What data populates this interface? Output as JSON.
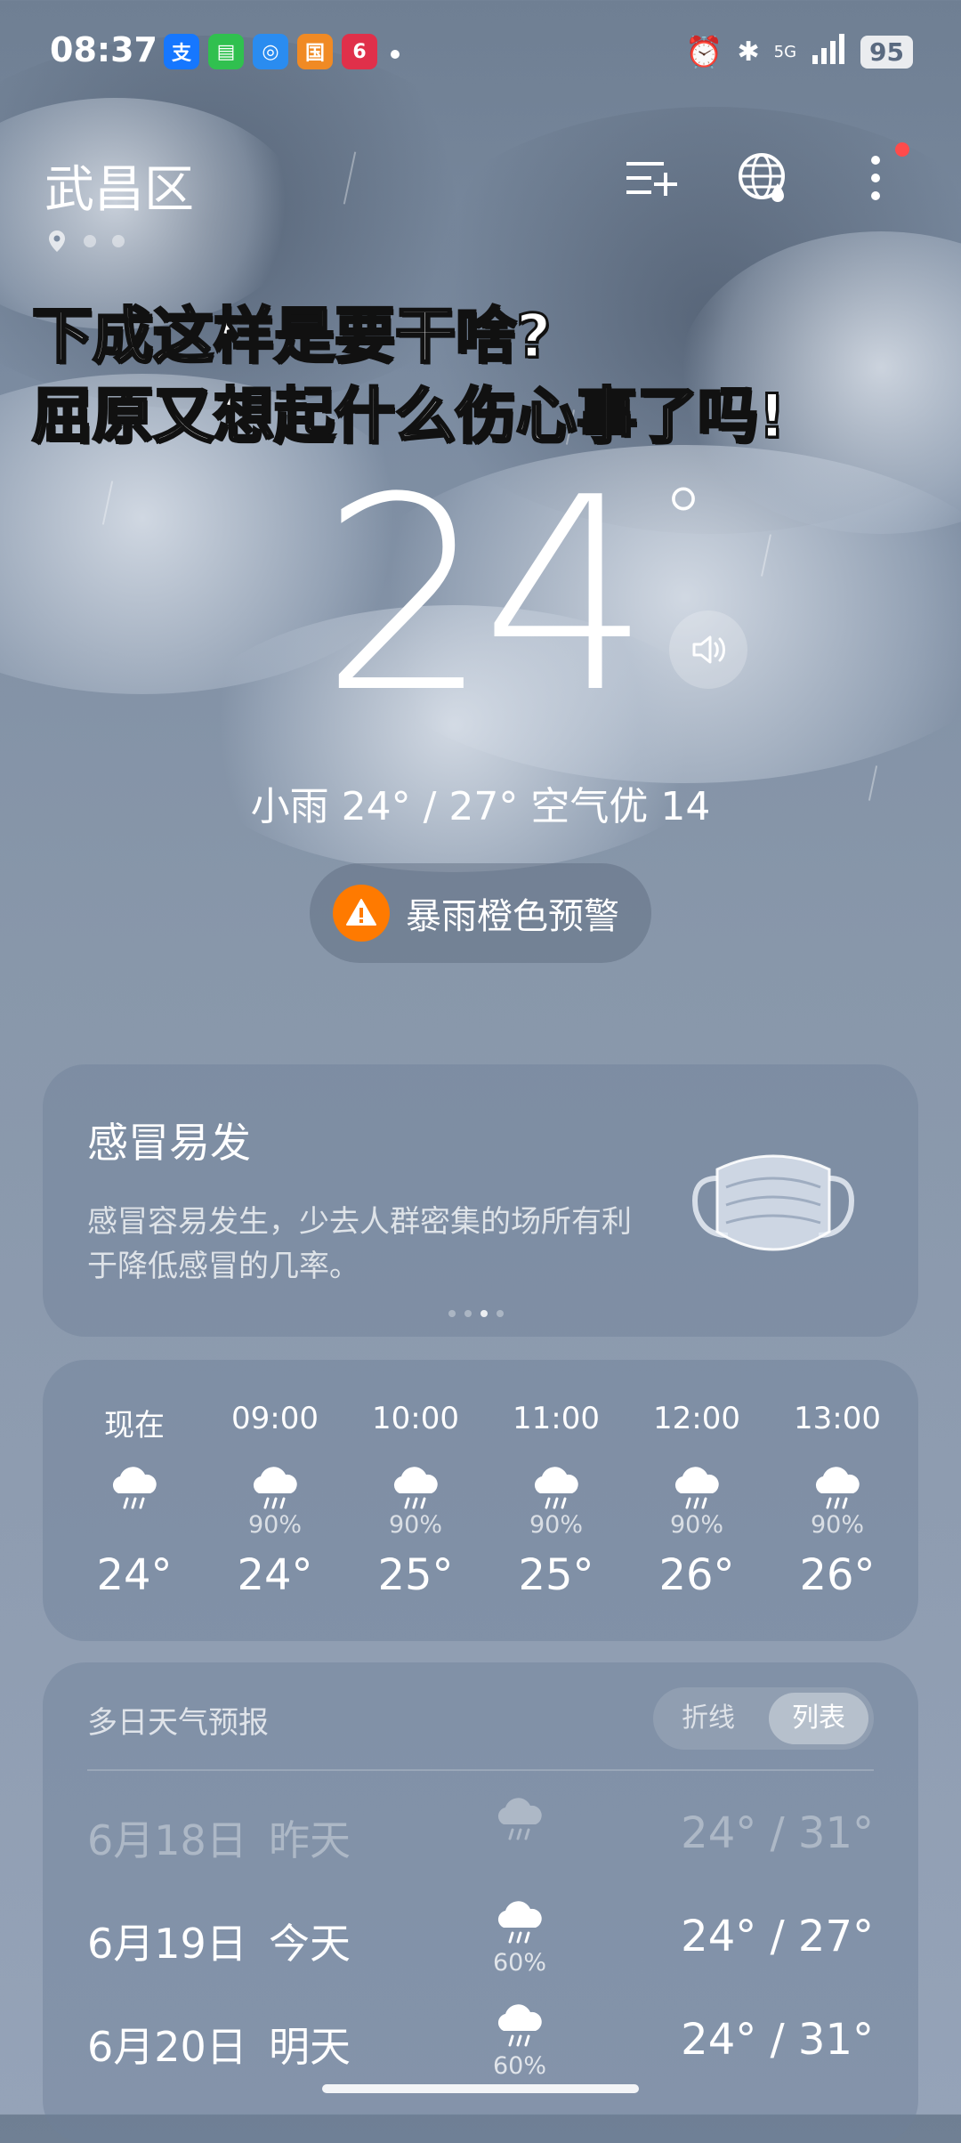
{
  "status_bar": {
    "time": "08:37",
    "battery": "95",
    "network": "5G",
    "app_icons": [
      {
        "glyph": "支",
        "color": "#1677ff",
        "name": "alipay-icon"
      },
      {
        "glyph": "▤",
        "color": "#30c04f",
        "name": "messages-icon"
      },
      {
        "glyph": "◎",
        "color": "#2a8cf0",
        "name": "app-icon"
      },
      {
        "glyph": "国",
        "color": "#f08a24",
        "name": "national-app-icon"
      },
      {
        "glyph": "6",
        "color": "#e0304a",
        "name": "shopping-app-icon"
      }
    ]
  },
  "header": {
    "city": "武昌区"
  },
  "caption": {
    "line1": "下成这样是要干啥?",
    "line2": "屈原又想起什么伤心事了吗!"
  },
  "current": {
    "temperature": "24",
    "degree_symbol": "°",
    "summary": "小雨  24° / 27°  空气优 14"
  },
  "alert": {
    "label": "暴雨橙色预警",
    "color": "#ff7a00"
  },
  "tip_card": {
    "title": "感冒易发",
    "text": "感冒容易发生，少去人群密集的场所有利于降低感冒的几率。",
    "pages": 4,
    "active_page": 3
  },
  "hourly": [
    {
      "time": "现在",
      "precip": "",
      "temp": "24°"
    },
    {
      "time": "09:00",
      "precip": "90%",
      "temp": "24°"
    },
    {
      "time": "10:00",
      "precip": "90%",
      "temp": "25°"
    },
    {
      "time": "11:00",
      "precip": "90%",
      "temp": "25°"
    },
    {
      "time": "12:00",
      "precip": "90%",
      "temp": "26°"
    },
    {
      "time": "13:00",
      "precip": "90%",
      "temp": "26°"
    }
  ],
  "forecast": {
    "title": "多日天气预报",
    "toggle": {
      "option1": "折线",
      "option2": "列表",
      "active": "列表"
    },
    "days": [
      {
        "date": "6月18日",
        "label": "昨天",
        "precip": "",
        "low": "24°",
        "high": "31°",
        "past": true
      },
      {
        "date": "6月19日",
        "label": "今天",
        "precip": "60%",
        "low": "24°",
        "high": "27°",
        "past": false
      },
      {
        "date": "6月20日",
        "label": "明天",
        "precip": "60%",
        "low": "24°",
        "high": "31°",
        "past": false
      }
    ]
  }
}
